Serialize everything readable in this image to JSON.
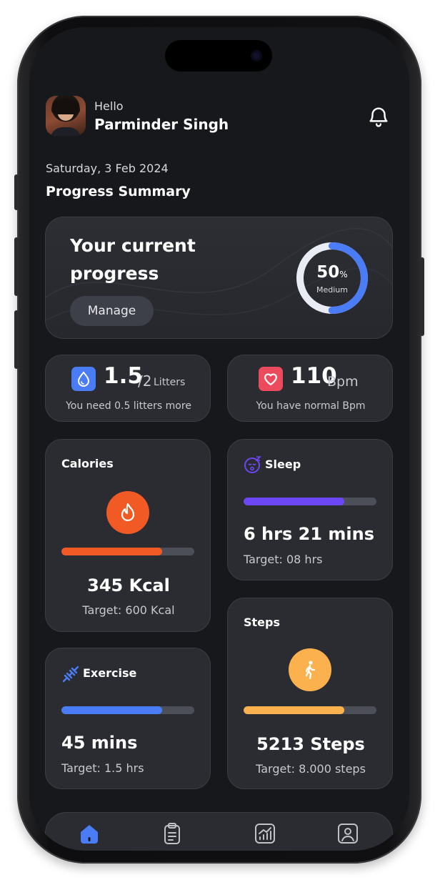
{
  "header": {
    "greeting": "Hello",
    "user_name": "Parminder Singh"
  },
  "date": "Saturday, 3 Feb 2024",
  "section_title": "Progress Summary",
  "progress": {
    "title": "Your current progress",
    "manage_label": "Manage",
    "value": "50",
    "percent_sign": "%",
    "level": "Medium",
    "fraction": 0.5,
    "accent_color": "#4a7cf6"
  },
  "water": {
    "amount": "1.5",
    "total": "/2",
    "unit": "Litters",
    "subtitle": "You need 0.5 litters more",
    "icon": "water-drop-icon",
    "color": "#4a7cf6"
  },
  "heart": {
    "amount": "110",
    "unit": "Bpm",
    "subtitle": "You have normal Bpm",
    "icon": "heart-icon",
    "color": "#ec4b5e"
  },
  "calories": {
    "label": "Calories",
    "value": "345 Kcal",
    "target": "Target: 600 Kcal",
    "fraction": 0.76,
    "color": "#f15a24",
    "icon": "fire-icon"
  },
  "sleep": {
    "label": "Sleep",
    "value": "6 hrs 21 mins",
    "target": "Target: 08 hrs",
    "fraction": 0.76,
    "color": "#6c47f5",
    "icon": "sleep-face-icon"
  },
  "exercise": {
    "label": "Exercise",
    "value": "45 mins",
    "target": "Target: 1.5 hrs",
    "fraction": 0.76,
    "color": "#4a7cf6",
    "icon": "dumbbell-icon"
  },
  "steps": {
    "label": "Steps",
    "value": "5213 Steps",
    "target": "Target: 8.000 steps",
    "fraction": 0.76,
    "color": "#fbb24e",
    "icon": "walking-icon"
  },
  "nav": {
    "items": [
      {
        "icon": "home-icon",
        "active": true
      },
      {
        "icon": "clipboard-icon",
        "active": false
      },
      {
        "icon": "chart-icon",
        "active": false
      },
      {
        "icon": "profile-icon",
        "active": false
      }
    ],
    "active_color": "#4a7cf6"
  }
}
